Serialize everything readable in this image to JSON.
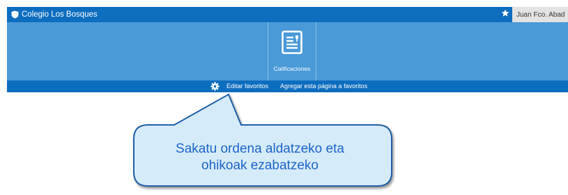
{
  "header": {
    "school_name": "Colegio Los Bosques",
    "user_name": "Juan Fco. Abad"
  },
  "favorites": {
    "items": [
      {
        "label": "Calificaciones",
        "icon": "document-icon"
      }
    ]
  },
  "toolbar": {
    "edit_favorites": "Editar favoritos",
    "add_to_favorites": "Agregar esta página a favoritos"
  },
  "callout": {
    "line1": "Sakatu ordena aldatzeko eta",
    "line2": "ohikoak ezabatzeko"
  },
  "colors": {
    "header_bg": "#0d6dbf",
    "favorites_bg": "#4a9ad8",
    "callout_fill": "#d6ebfa",
    "callout_text": "#1d64c8"
  }
}
